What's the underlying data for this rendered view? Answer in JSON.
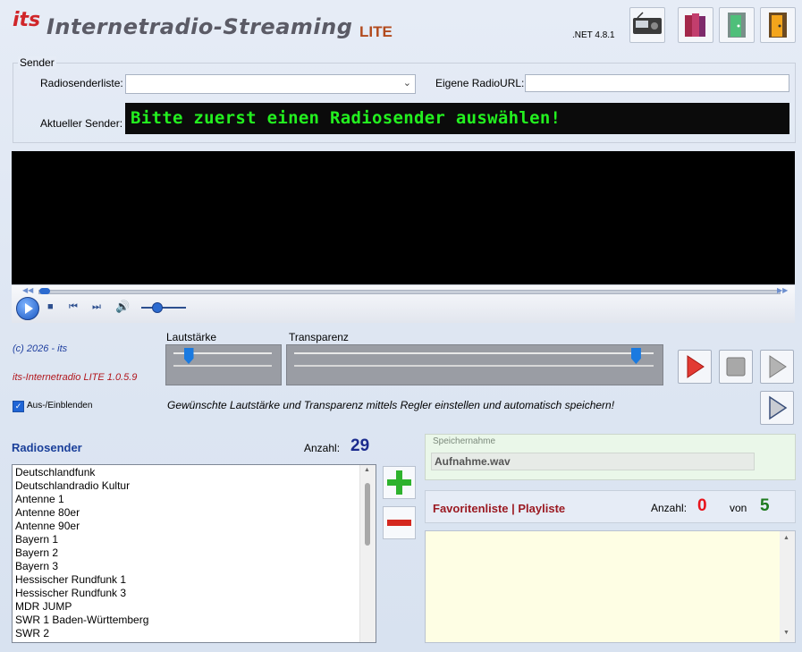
{
  "header": {
    "logo_text": "its",
    "title": "Internetradio-Streaming",
    "edition": "LITE",
    "framework": ".NET 4.8.1"
  },
  "toolbar": {
    "buttons": [
      {
        "icon": "radio-icon"
      },
      {
        "icon": "books-icon"
      },
      {
        "icon": "door-exit-icon"
      },
      {
        "icon": "door-open-icon"
      }
    ]
  },
  "sender": {
    "group_label": "Sender",
    "list_label": "Radiosenderliste:",
    "list_value": "",
    "url_label": "Eigene RadioURL:",
    "url_value": "",
    "current_label": "Aktueller Sender:",
    "current_display": "Bitte zuerst einen Radiosender auswählen!"
  },
  "about": {
    "copyright": "(c) 2026 - its",
    "version": "its-Internetradio LITE 1.0.5.9"
  },
  "sliders": {
    "volume_label": "Lautstärke",
    "transparency_label": "Transparenz",
    "volume_level": 0.15,
    "transparency_level": 0.95
  },
  "options": {
    "toggle_label": "Aus-/Einblenden",
    "toggle_checked": true,
    "hint": "Gewünschte Lautstärke und Transparenz mittels Regler einstellen und automatisch speichern!"
  },
  "stations": {
    "title": "Radiosender",
    "count_label": "Anzahl:",
    "count": "29",
    "items": [
      "Deutschlandfunk",
      "Deutschlandradio Kultur",
      "Antenne 1",
      "Antenne 80er",
      "Antenne 90er",
      "Bayern 1",
      "Bayern 2",
      "Bayern 3",
      "Hessischer Rundfunk 1",
      "Hessischer Rundfunk 3",
      "MDR JUMP",
      "SWR 1 Baden-Württemberg",
      "SWR 2"
    ]
  },
  "recording": {
    "save_label": "Speichernahme",
    "filename": "Aufnahme.wav"
  },
  "favorites": {
    "title": "Favoritenliste | Playliste",
    "count_label": "Anzahl:",
    "count": "0",
    "of_label": "von",
    "total": "5"
  },
  "colors": {
    "lcd_text": "#23f01f",
    "fav_count": "#e8141c",
    "fav_total": "#1e7a1e",
    "station_count": "#1b2b8e",
    "accent_blue": "#1a3f9a"
  }
}
